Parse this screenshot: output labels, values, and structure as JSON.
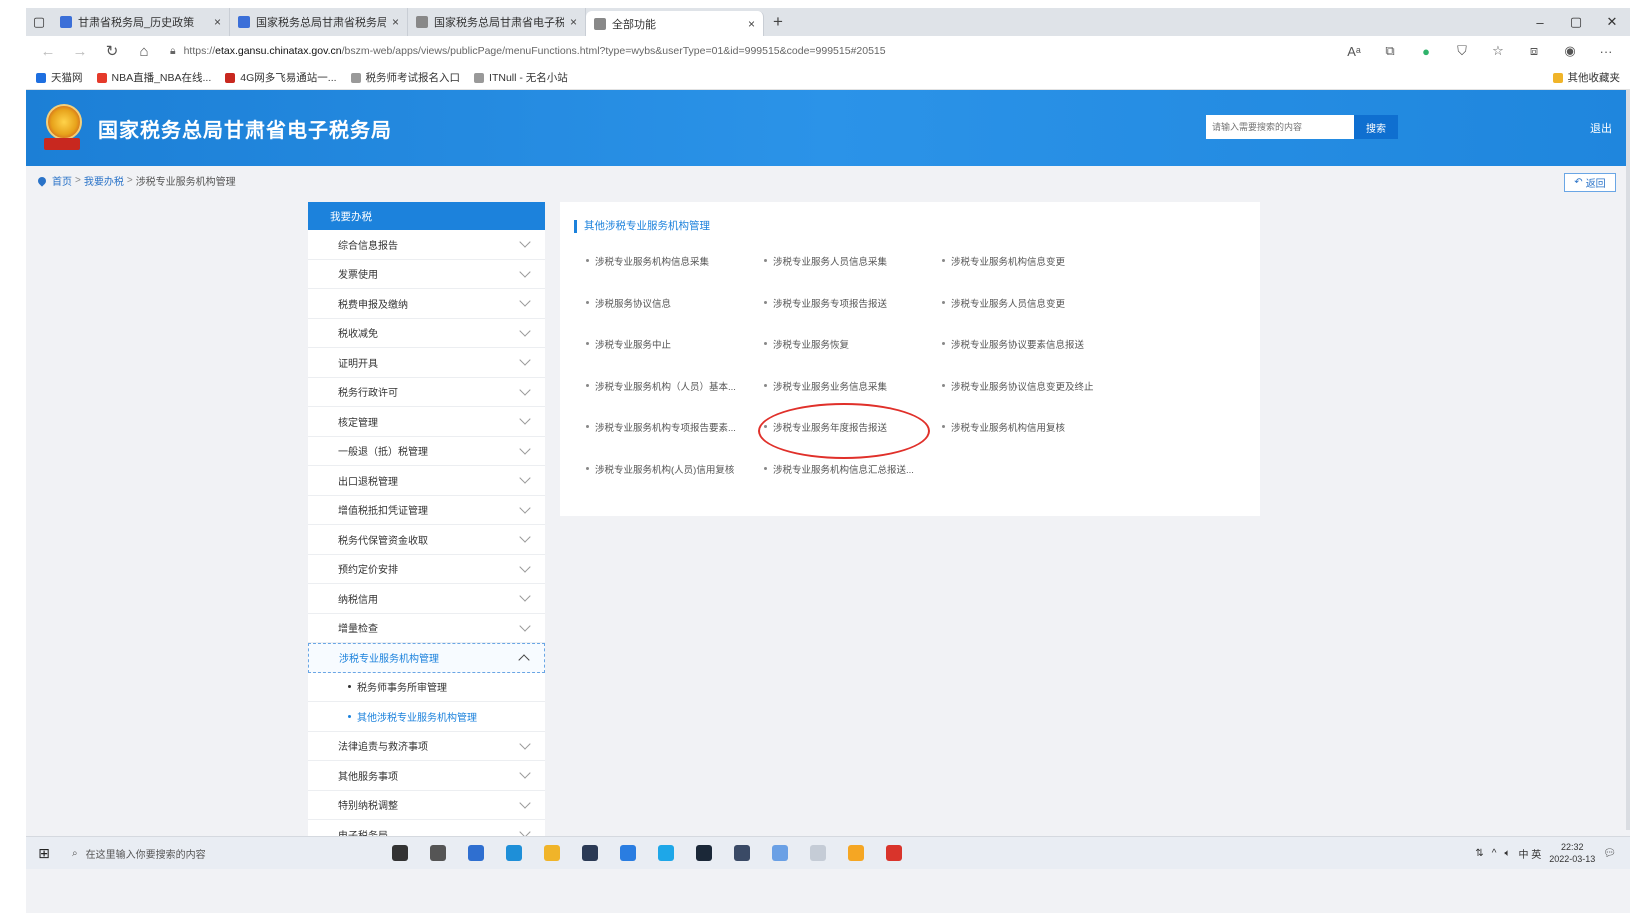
{
  "browser": {
    "tabs": [
      {
        "title": "甘肃省税务局_历史政策",
        "color": "#3b6fd8",
        "active": false
      },
      {
        "title": "国家税务总局甘肃省税务局",
        "color": "#3b6fd8",
        "active": false
      },
      {
        "title": "国家税务总局甘肃省电子税务局",
        "color": "#888888",
        "active": false
      },
      {
        "title": "全部功能",
        "color": "#888888",
        "active": true
      }
    ],
    "close_glyph": "×",
    "new_tab_glyph": "+",
    "window_controls": [
      "–",
      "▢",
      "✕"
    ],
    "url_scheme": "https://",
    "url_domain": "etax.gansu.chinatax.gov.cn",
    "url_path": "/bszm-web/apps/views/publicPage/menuFunctions.html?type=wybs&userType=01&id=999515&code=999515#20515",
    "bookmarks": [
      {
        "label": "天猫网",
        "color": "#1e6fe0"
      },
      {
        "label": "NBA直播_NBA在线...",
        "color": "#e53a2b"
      },
      {
        "label": "4G网多飞易通站一...",
        "color": "#c8281f"
      },
      {
        "label": "税务师考试报名入口",
        "color": "#999999"
      },
      {
        "label": "ITNull - 无名小站",
        "color": "#999999"
      }
    ],
    "bookmarks_other": "其他收藏夹"
  },
  "site": {
    "title": "国家税务总局甘肃省电子税务局",
    "search_placeholder": "请输入需要搜索的内容",
    "search_button": "搜索",
    "logout": "退出"
  },
  "breadcrumb": {
    "home": "首页",
    "level1": "我要办税",
    "level2": "涉税专业服务机构管理",
    "sep": ">"
  },
  "back_button": "返回",
  "sidebar": {
    "header": "我要办税",
    "items_before": [
      "综合信息报告",
      "发票使用",
      "税费申报及缴纳",
      "税收减免",
      "证明开具",
      "税务行政许可",
      "核定管理",
      "一般退（抵）税管理",
      "出口退税管理",
      "增值税抵扣凭证管理",
      "税务代保管资金收取",
      "预约定价安排",
      "纳税信用",
      "增量检查"
    ],
    "open_item": "涉税专业服务机构管理",
    "sub_items": [
      {
        "label": "税务师事务所审管理",
        "active": false
      },
      {
        "label": "其他涉税专业服务机构管理",
        "active": true
      }
    ],
    "items_after": [
      "法律追责与救济事项",
      "其他服务事项",
      "特别纳税调整",
      "电子税务局"
    ]
  },
  "panel": {
    "title": "其他涉税专业服务机构管理",
    "links": [
      "涉税专业服务机构信息采集",
      "涉税专业服务人员信息采集",
      "涉税专业服务机构信息变更",
      "涉税服务协议信息",
      "涉税专业服务专项报告报送",
      "涉税专业服务人员信息变更",
      "涉税专业服务中止",
      "涉税专业服务恢复",
      "涉税专业服务协议要素信息报送",
      "涉税专业服务机构（人员）基本...",
      "涉税专业服务业务信息采集",
      "涉税专业服务协议信息变更及终止",
      "涉税专业服务机构专项报告要素...",
      "涉税专业服务年度报告报送",
      "涉税专业服务机构信用复核",
      "涉税专业服务机构(人员)信用复核",
      "涉税专业服务机构信息汇总报送..."
    ],
    "highlighted_link": "涉税专业服务年度报告报送"
  },
  "taskbar": {
    "search_placeholder": "在这里输入你要搜索的内容",
    "time": "22:32",
    "date": "2022-03-13",
    "tray_text": "中 英",
    "apps": [
      {
        "name": "task-view",
        "color": "#333333"
      },
      {
        "name": "explorer-file",
        "color": "#555555"
      },
      {
        "name": "calendar",
        "color": "#2f6fd0"
      },
      {
        "name": "edge",
        "color": "#1e8fd8"
      },
      {
        "name": "folder",
        "color": "#f0b429"
      },
      {
        "name": "dark-app",
        "color": "#2b3a55"
      },
      {
        "name": "mail",
        "color": "#2a7de1"
      },
      {
        "name": "video",
        "color": "#1ea7e8"
      },
      {
        "name": "steam",
        "color": "#1b2838"
      },
      {
        "name": "circle-app",
        "color": "#3a4a66"
      },
      {
        "name": "pen-app",
        "color": "#6aa0e5"
      },
      {
        "name": "tool-app",
        "color": "#c5ccd6"
      },
      {
        "name": "chat-app",
        "color": "#f5a623"
      },
      {
        "name": "wps",
        "color": "#d9342b"
      }
    ]
  },
  "colors": {
    "header_blue": "#1c7fd6",
    "menu_active": "#1c82dc",
    "highlight_circle": "#e0302a"
  }
}
